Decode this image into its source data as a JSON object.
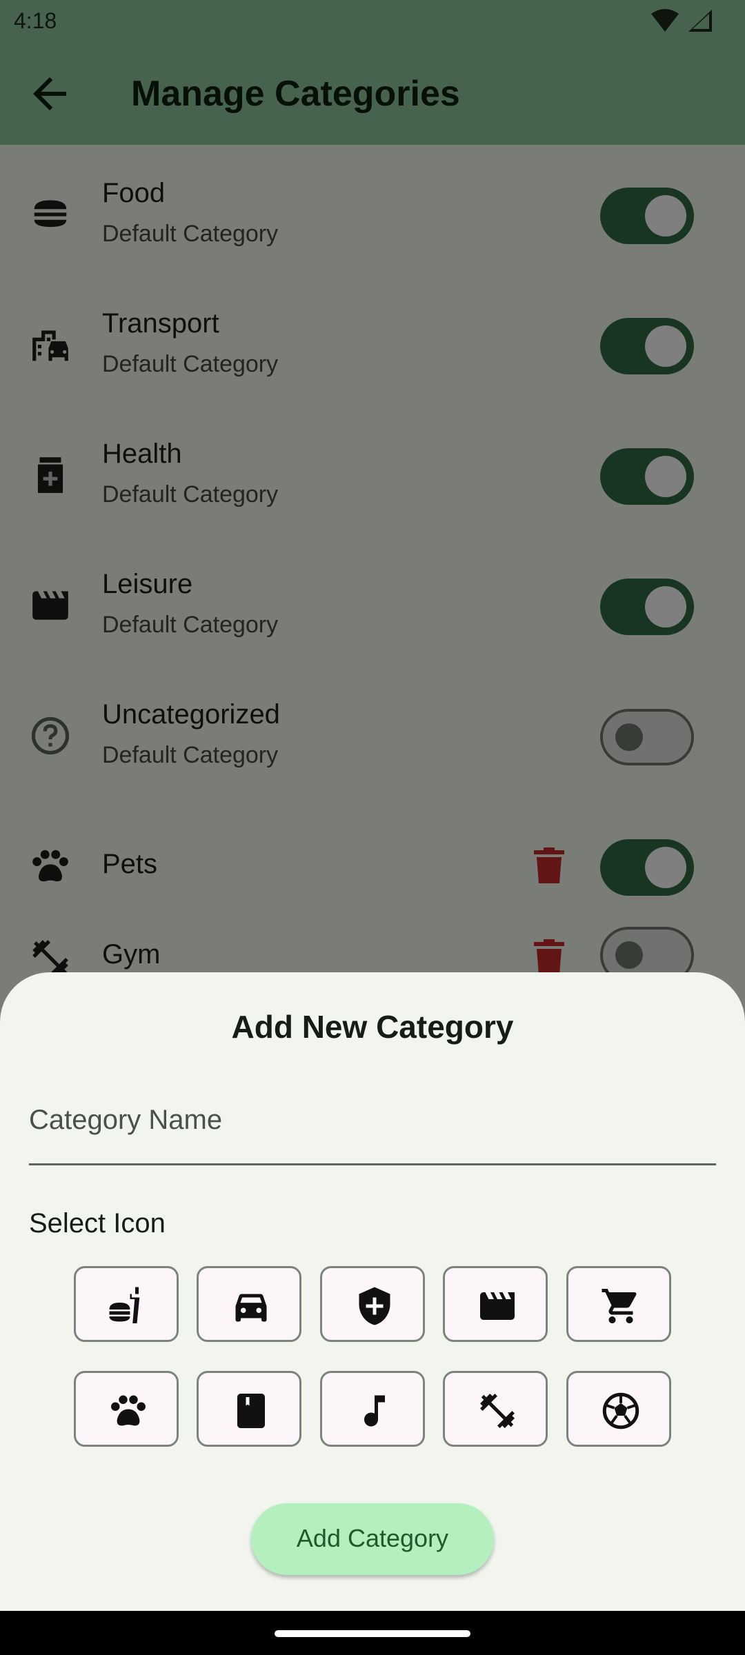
{
  "status_bar": {
    "time": "4:18"
  },
  "app_bar": {
    "title": "Manage Categories",
    "back_icon": "arrow-left-icon"
  },
  "categories": [
    {
      "name": "Food",
      "subtitle": "Default Category",
      "icon": "fastfood-icon",
      "enabled": true,
      "deletable": false
    },
    {
      "name": "Transport",
      "subtitle": "Default Category",
      "icon": "emoji-transportation-icon",
      "enabled": true,
      "deletable": false
    },
    {
      "name": "Health",
      "subtitle": "Default Category",
      "icon": "medication-icon",
      "enabled": true,
      "deletable": false
    },
    {
      "name": "Leisure",
      "subtitle": "Default Category",
      "icon": "movie-icon",
      "enabled": true,
      "deletable": false
    },
    {
      "name": "Uncategorized",
      "subtitle": "Default Category",
      "icon": "help-outline-icon",
      "enabled": false,
      "deletable": false
    },
    {
      "name": "Pets",
      "subtitle": "",
      "icon": "pets-icon",
      "enabled": true,
      "deletable": true
    },
    {
      "name": "Gym",
      "subtitle": "",
      "icon": "fitness-center-icon",
      "enabled": false,
      "deletable": true
    }
  ],
  "sheet": {
    "title": "Add New Category",
    "name_field": {
      "placeholder": "Category Name",
      "value": ""
    },
    "select_icon_label": "Select Icon",
    "icons": [
      "fastfood-icon",
      "car-icon",
      "health-shield-icon",
      "movie-icon",
      "shopping-cart-icon",
      "pets-icon",
      "book-icon",
      "music-note-icon",
      "fitness-center-icon",
      "soccer-ball-icon"
    ],
    "add_button_label": "Add Category"
  },
  "colors": {
    "app_bar": "#8fc79a",
    "toggle_on": "#2f6a40",
    "delete": "#c62828",
    "add_button": "#b4efbf"
  }
}
